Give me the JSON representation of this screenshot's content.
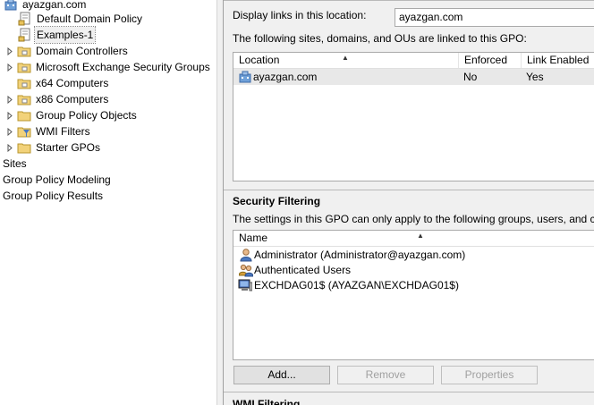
{
  "tree": {
    "items": [
      {
        "label": "ayazgan.com",
        "icon": "domain-icon",
        "expander": "none"
      },
      {
        "label": "Default Domain Policy",
        "icon": "gpo-link-icon",
        "expander": "none"
      },
      {
        "label": "Examples-1",
        "icon": "gpo-link-icon",
        "expander": "none",
        "selected": true
      },
      {
        "label": "Domain Controllers",
        "icon": "ou-folder-icon",
        "expander": "collapsed"
      },
      {
        "label": "Microsoft Exchange Security Groups",
        "icon": "ou-folder-icon",
        "expander": "collapsed"
      },
      {
        "label": "x64 Computers",
        "icon": "ou-folder-icon",
        "expander": "none"
      },
      {
        "label": "x86 Computers",
        "icon": "ou-folder-icon",
        "expander": "collapsed"
      },
      {
        "label": "Group Policy Objects",
        "icon": "folder-icon",
        "expander": "collapsed"
      },
      {
        "label": "WMI Filters",
        "icon": "wmi-filter-folder-icon",
        "expander": "collapsed"
      },
      {
        "label": "Starter GPOs",
        "icon": "folder-icon",
        "expander": "collapsed"
      },
      {
        "label": "Sites",
        "icon": "",
        "expander": "none"
      },
      {
        "label": "Group Policy Modeling",
        "icon": "",
        "expander": "none"
      },
      {
        "label": "Group Policy Results",
        "icon": "",
        "expander": "none"
      }
    ]
  },
  "links": {
    "display_label": "Display links in this location:",
    "display_value": "ayazgan.com",
    "linked_label": "The following sites, domains, and OUs are linked to this GPO:",
    "columns": [
      "Location",
      "Enforced",
      "Link Enabled"
    ],
    "rows": [
      {
        "location": "ayazgan.com",
        "enforced": "No",
        "enabled": "Yes"
      }
    ]
  },
  "security": {
    "title": "Security Filtering",
    "description": "The settings in this GPO can only apply to the following groups, users, and computers:",
    "column": "Name",
    "entries": [
      {
        "name": "Administrator (Administrator@ayazgan.com)",
        "icon": "user-icon"
      },
      {
        "name": "Authenticated Users",
        "icon": "group-icon"
      },
      {
        "name": "EXCHDAG01$ (AYAZGAN\\EXCHDAG01$)",
        "icon": "computer-icon"
      }
    ],
    "buttons": {
      "add": "Add...",
      "remove": "Remove",
      "properties": "Properties"
    }
  },
  "wmi": {
    "title": "WMI Filtering"
  }
}
